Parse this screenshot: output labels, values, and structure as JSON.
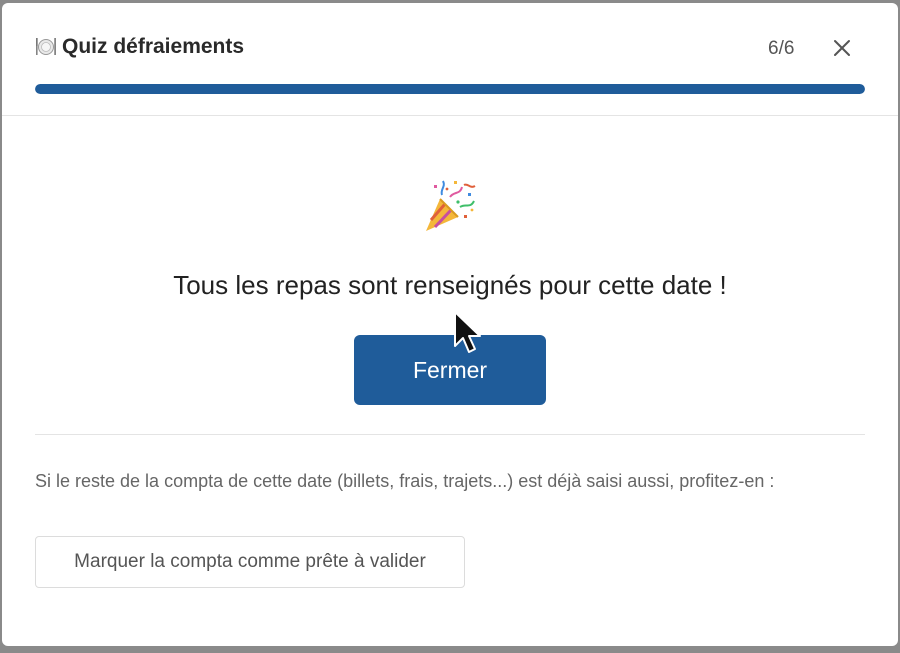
{
  "modal": {
    "title_icon": "plate-cutlery-icon",
    "title": "Quiz défraiements",
    "step": "6/6",
    "close_icon": "close-icon",
    "progress": 1.0,
    "accent_color": "#1f5c9a"
  },
  "body": {
    "emoji_icon": "party-popper-icon",
    "message": "Tous les repas sont renseignés pour cette date !",
    "close_button_label": "Fermer",
    "hint": "Si le reste de la compta de cette date (billets, frais, trajets...) est déjà saisi aussi, profitez-en :",
    "mark_button_label": "Marquer la compta comme prête à valider"
  }
}
